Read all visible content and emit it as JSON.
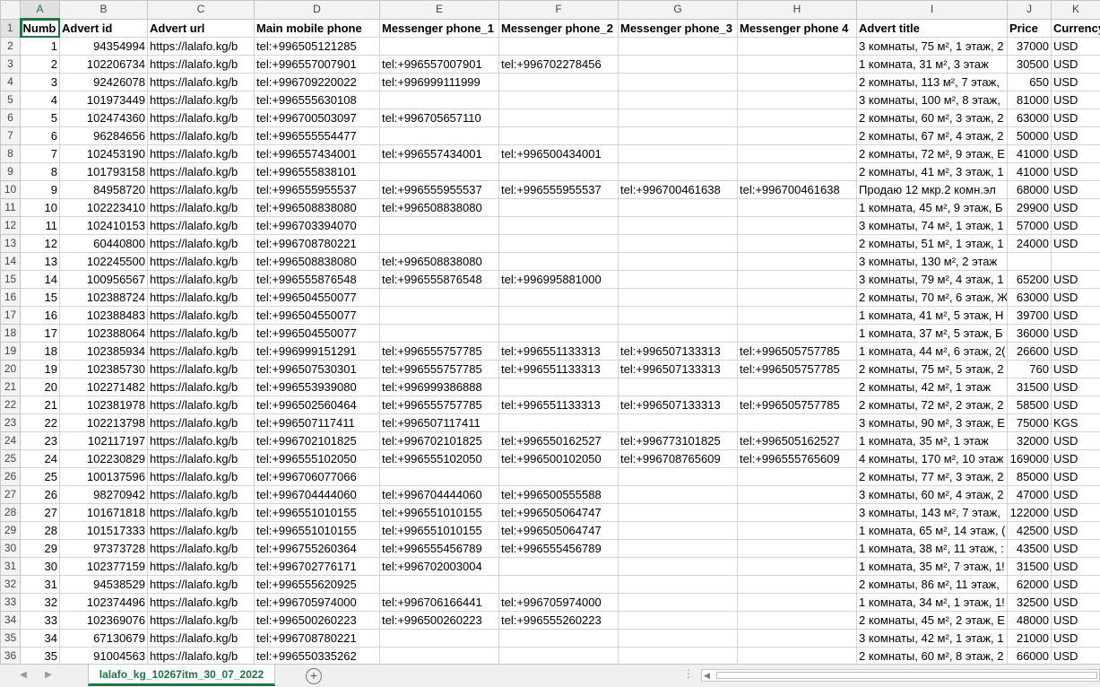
{
  "columns": [
    "A",
    "B",
    "C",
    "D",
    "E",
    "F",
    "G",
    "H",
    "I",
    "J",
    "K"
  ],
  "header_row": {
    "row_number": "1",
    "cells": [
      "Numb",
      "Advert id",
      "Advert url",
      "Main mobile phone",
      "Messenger phone_1",
      "Messenger phone_2",
      "Messenger phone_3",
      "Messenger phone 4",
      "Advert title",
      "Price",
      "Currency"
    ]
  },
  "rows": [
    {
      "r": "2",
      "cells": [
        "1",
        "94354994",
        "https://lalafo.kg/b",
        "tel:+996505121285",
        "",
        "",
        "",
        "",
        "3 комнаты, 75 м², 1 этаж, 2",
        "37000",
        "USD"
      ]
    },
    {
      "r": "3",
      "cells": [
        "2",
        "102206734",
        "https://lalafo.kg/b",
        "tel:+996557007901",
        "tel:+996557007901",
        "tel:+996702278456",
        "",
        "",
        "1 комната, 31 м², 3 этаж",
        "30500",
        "USD"
      ]
    },
    {
      "r": "4",
      "cells": [
        "3",
        "92426078",
        "https://lalafo.kg/b",
        "tel:+996709220022",
        "tel:+996999111999",
        "",
        "",
        "",
        "2 комнаты, 113 м², 7 этаж,",
        "650",
        "USD"
      ]
    },
    {
      "r": "5",
      "cells": [
        "4",
        "101973449",
        "https://lalafo.kg/b",
        "tel:+996555630108",
        "",
        "",
        "",
        "",
        "3 комнаты, 100 м², 8 этаж,",
        "81000",
        "USD"
      ]
    },
    {
      "r": "6",
      "cells": [
        "5",
        "102474360",
        "https://lalafo.kg/b",
        "tel:+996700503097",
        "tel:+996705657110",
        "",
        "",
        "",
        "2 комнаты, 60 м², 3 этаж, 2",
        "63000",
        "USD"
      ]
    },
    {
      "r": "7",
      "cells": [
        "6",
        "96284656",
        "https://lalafo.kg/b",
        "tel:+996555554477",
        "",
        "",
        "",
        "",
        "2 комнаты, 67 м², 4 этаж, 2",
        "50000",
        "USD"
      ]
    },
    {
      "r": "8",
      "cells": [
        "7",
        "102453190",
        "https://lalafo.kg/b",
        "tel:+996557434001",
        "tel:+996557434001",
        "tel:+996500434001",
        "",
        "",
        "2 комнаты, 72 м², 9 этаж, Е",
        "41000",
        "USD"
      ]
    },
    {
      "r": "9",
      "cells": [
        "8",
        "101793158",
        "https://lalafo.kg/b",
        "tel:+996555838101",
        "",
        "",
        "",
        "",
        "2 комнаты, 41 м², 3 этаж, 1",
        "41000",
        "USD"
      ]
    },
    {
      "r": "10",
      "cells": [
        "9",
        "84958720",
        "https://lalafo.kg/b",
        "tel:+996555955537",
        "tel:+996555955537",
        "tel:+996555955537",
        "tel:+996700461638",
        "tel:+996700461638",
        "Продаю 12 мкр.2 комн.эл",
        "68000",
        "USD"
      ]
    },
    {
      "r": "11",
      "cells": [
        "10",
        "102223410",
        "https://lalafo.kg/b",
        "tel:+996508838080",
        "tel:+996508838080",
        "",
        "",
        "",
        "1 комната, 45 м², 9 этаж, Б",
        "29900",
        "USD"
      ]
    },
    {
      "r": "12",
      "cells": [
        "11",
        "102410153",
        "https://lalafo.kg/b",
        "tel:+996703394070",
        "",
        "",
        "",
        "",
        "3 комнаты, 74 м², 1 этаж, 1",
        "57000",
        "USD"
      ]
    },
    {
      "r": "13",
      "cells": [
        "12",
        "60440800",
        "https://lalafo.kg/b",
        "tel:+996708780221",
        "",
        "",
        "",
        "",
        "2 комнаты, 51 м², 1 этаж, 1",
        "24000",
        "USD"
      ]
    },
    {
      "r": "14",
      "cells": [
        "13",
        "102245500",
        "https://lalafo.kg/b",
        "tel:+996508838080",
        "tel:+996508838080",
        "",
        "",
        "",
        "3 комнаты, 130 м², 2 этаж",
        "",
        ""
      ]
    },
    {
      "r": "15",
      "cells": [
        "14",
        "100956567",
        "https://lalafo.kg/b",
        "tel:+996555876548",
        "tel:+996555876548",
        "tel:+996995881000",
        "",
        "",
        "3 комнаты, 79 м², 4 этаж, 1",
        "65200",
        "USD"
      ]
    },
    {
      "r": "16",
      "cells": [
        "15",
        "102388724",
        "https://lalafo.kg/b",
        "tel:+996504550077",
        "",
        "",
        "",
        "",
        "2 комнаты, 70 м², 6 этаж, Ж",
        "63000",
        "USD"
      ]
    },
    {
      "r": "17",
      "cells": [
        "16",
        "102388483",
        "https://lalafo.kg/b",
        "tel:+996504550077",
        "",
        "",
        "",
        "",
        "1 комната, 41 м², 5 этаж, Н",
        "39700",
        "USD"
      ]
    },
    {
      "r": "18",
      "cells": [
        "17",
        "102388064",
        "https://lalafo.kg/b",
        "tel:+996504550077",
        "",
        "",
        "",
        "",
        "1 комната, 37 м², 5 этаж, Б",
        "36000",
        "USD"
      ]
    },
    {
      "r": "19",
      "cells": [
        "18",
        "102385934",
        "https://lalafo.kg/b",
        "tel:+996999151291",
        "tel:+996555757785",
        "tel:+996551133313",
        "tel:+996507133313",
        "tel:+996505757785",
        "1 комната, 44 м², 6 этаж, 2(",
        "26600",
        "USD"
      ]
    },
    {
      "r": "20",
      "cells": [
        "19",
        "102385730",
        "https://lalafo.kg/b",
        "tel:+996507530301",
        "tel:+996555757785",
        "tel:+996551133313",
        "tel:+996507133313",
        "tel:+996505757785",
        "2 комнаты, 75 м², 5 этаж, 2",
        "760",
        "USD"
      ]
    },
    {
      "r": "21",
      "cells": [
        "20",
        "102271482",
        "https://lalafo.kg/b",
        "tel:+996553939080",
        "tel:+996999386888",
        "",
        "",
        "",
        "2 комнаты, 42 м², 1 этаж",
        "31500",
        "USD"
      ]
    },
    {
      "r": "22",
      "cells": [
        "21",
        "102381978",
        "https://lalafo.kg/b",
        "tel:+996502560464",
        "tel:+996555757785",
        "tel:+996551133313",
        "tel:+996507133313",
        "tel:+996505757785",
        "2 комнаты, 72 м², 2 этаж, 2",
        "58500",
        "USD"
      ]
    },
    {
      "r": "23",
      "cells": [
        "22",
        "102213798",
        "https://lalafo.kg/b",
        "tel:+996507117411",
        "tel:+996507117411",
        "",
        "",
        "",
        "3 комнаты, 90 м², 3 этаж, Е",
        "75000",
        "KGS"
      ]
    },
    {
      "r": "24",
      "cells": [
        "23",
        "102117197",
        "https://lalafo.kg/b",
        "tel:+996702101825",
        "tel:+996702101825",
        "tel:+996550162527",
        "tel:+996773101825",
        "tel:+996505162527",
        "1 комната, 35 м², 1 этаж",
        "32000",
        "USD"
      ]
    },
    {
      "r": "25",
      "cells": [
        "24",
        "102230829",
        "https://lalafo.kg/b",
        "tel:+996555102050",
        "tel:+996555102050",
        "tel:+996500102050",
        "tel:+996708765609",
        "tel:+996555765609",
        "4 комнаты, 170 м², 10 этаж",
        "169000",
        "USD"
      ]
    },
    {
      "r": "26",
      "cells": [
        "25",
        "100137596",
        "https://lalafo.kg/b",
        "tel:+996706077066",
        "",
        "",
        "",
        "",
        "2 комнаты, 77 м², 3 этаж, 2",
        "85000",
        "USD"
      ]
    },
    {
      "r": "27",
      "cells": [
        "26",
        "98270942",
        "https://lalafo.kg/b",
        "tel:+996704444060",
        "tel:+996704444060",
        "tel:+996500555588",
        "",
        "",
        "3 комнаты, 60 м², 4 этаж, 2",
        "47000",
        "USD"
      ]
    },
    {
      "r": "28",
      "cells": [
        "27",
        "101671818",
        "https://lalafo.kg/b",
        "tel:+996551010155",
        "tel:+996551010155",
        "tel:+996505064747",
        "",
        "",
        "3 комнаты, 143 м², 7 этаж,",
        "122000",
        "USD"
      ]
    },
    {
      "r": "29",
      "cells": [
        "28",
        "101517333",
        "https://lalafo.kg/b",
        "tel:+996551010155",
        "tel:+996551010155",
        "tel:+996505064747",
        "",
        "",
        "1 комната, 65 м², 14 этаж, (",
        "42500",
        "USD"
      ]
    },
    {
      "r": "30",
      "cells": [
        "29",
        "97373728",
        "https://lalafo.kg/b",
        "tel:+996755260364",
        "tel:+996555456789",
        "tel:+996555456789",
        "",
        "",
        "1 комната, 38 м², 11 этаж, :",
        "43500",
        "USD"
      ]
    },
    {
      "r": "31",
      "cells": [
        "30",
        "102377159",
        "https://lalafo.kg/b",
        "tel:+996702776171",
        "tel:+996702003004",
        "",
        "",
        "",
        "1 комната, 35 м², 7 этаж, 1!",
        "31500",
        "USD"
      ]
    },
    {
      "r": "32",
      "cells": [
        "31",
        "94538529",
        "https://lalafo.kg/b",
        "tel:+996555620925",
        "",
        "",
        "",
        "",
        "2 комнаты, 86 м², 11 этаж,",
        "62000",
        "USD"
      ]
    },
    {
      "r": "33",
      "cells": [
        "32",
        "102374496",
        "https://lalafo.kg/b",
        "tel:+996705974000",
        "tel:+996706166441",
        "tel:+996705974000",
        "",
        "",
        "1 комната, 34 м², 1 этаж, 1!",
        "32500",
        "USD"
      ]
    },
    {
      "r": "34",
      "cells": [
        "33",
        "102369076",
        "https://lalafo.kg/b",
        "tel:+996500260223",
        "tel:+996500260223",
        "tel:+996555260223",
        "",
        "",
        "2 комнаты, 45 м², 2 этаж, Е",
        "48000",
        "USD"
      ]
    },
    {
      "r": "35",
      "cells": [
        "34",
        "67130679",
        "https://lalafo.kg/b",
        "tel:+996708780221",
        "",
        "",
        "",
        "",
        "3 комнаты, 42 м², 1 этаж, 1",
        "21000",
        "USD"
      ]
    },
    {
      "r": "36",
      "cells": [
        "35",
        "91004563",
        "https://lalafo.kg/b",
        "tel:+996550335262",
        "",
        "",
        "",
        "",
        "2 комнаты, 60 м², 8 этаж, 2",
        "66000",
        "USD"
      ]
    }
  ],
  "sheet_tab": {
    "label": "lalafo_kg_10267itm_30_07_2022"
  },
  "icons": {
    "prev_sheet": "caret-left-icon",
    "next_sheet": "caret-right-icon",
    "add_sheet": "plus-circle-icon"
  },
  "colors": {
    "accent": "#217346"
  }
}
